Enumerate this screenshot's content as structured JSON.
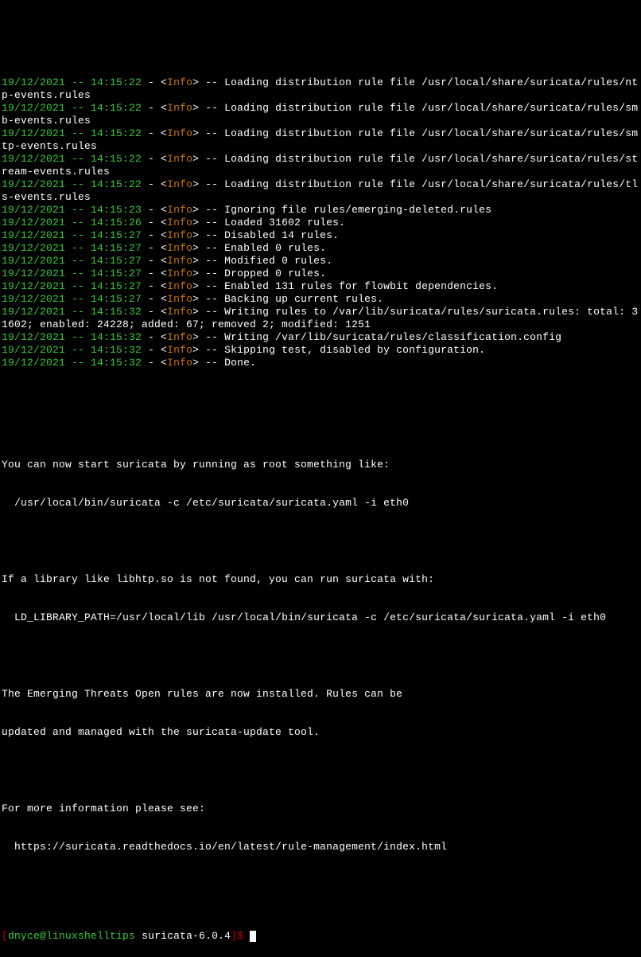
{
  "log": [
    {
      "ts": "19/12/2021 -- 14:15:22",
      "lvl": "Info",
      "msg": "Loading distribution rule file /usr/local/share/suricata/rules/ntp-events.rules"
    },
    {
      "ts": "19/12/2021 -- 14:15:22",
      "lvl": "Info",
      "msg": "Loading distribution rule file /usr/local/share/suricata/rules/smb-events.rules"
    },
    {
      "ts": "19/12/2021 -- 14:15:22",
      "lvl": "Info",
      "msg": "Loading distribution rule file /usr/local/share/suricata/rules/smtp-events.rules"
    },
    {
      "ts": "19/12/2021 -- 14:15:22",
      "lvl": "Info",
      "msg": "Loading distribution rule file /usr/local/share/suricata/rules/stream-events.rules"
    },
    {
      "ts": "19/12/2021 -- 14:15:22",
      "lvl": "Info",
      "msg": "Loading distribution rule file /usr/local/share/suricata/rules/tls-events.rules"
    },
    {
      "ts": "19/12/2021 -- 14:15:23",
      "lvl": "Info",
      "msg": "Ignoring file rules/emerging-deleted.rules"
    },
    {
      "ts": "19/12/2021 -- 14:15:26",
      "lvl": "Info",
      "msg": "Loaded 31602 rules."
    },
    {
      "ts": "19/12/2021 -- 14:15:27",
      "lvl": "Info",
      "msg": "Disabled 14 rules."
    },
    {
      "ts": "19/12/2021 -- 14:15:27",
      "lvl": "Info",
      "msg": "Enabled 0 rules."
    },
    {
      "ts": "19/12/2021 -- 14:15:27",
      "lvl": "Info",
      "msg": "Modified 0 rules."
    },
    {
      "ts": "19/12/2021 -- 14:15:27",
      "lvl": "Info",
      "msg": "Dropped 0 rules."
    },
    {
      "ts": "19/12/2021 -- 14:15:27",
      "lvl": "Info",
      "msg": "Enabled 131 rules for flowbit dependencies."
    },
    {
      "ts": "19/12/2021 -- 14:15:27",
      "lvl": "Info",
      "msg": "Backing up current rules."
    },
    {
      "ts": "19/12/2021 -- 14:15:32",
      "lvl": "Info",
      "msg": "Writing rules to /var/lib/suricata/rules/suricata.rules: total: 31602; enabled: 24228; added: 67; removed 2; modified: 1251"
    },
    {
      "ts": "19/12/2021 -- 14:15:32",
      "lvl": "Info",
      "msg": "Writing /var/lib/suricata/rules/classification.config"
    },
    {
      "ts": "19/12/2021 -- 14:15:32",
      "lvl": "Info",
      "msg": "Skipping test, disabled by configuration."
    },
    {
      "ts": "19/12/2021 -- 14:15:32",
      "lvl": "Info",
      "msg": "Done."
    }
  ],
  "body": {
    "p1l1": "You can now start suricata by running as root something like:",
    "p1l2": "  /usr/local/bin/suricata -c /etc/suricata/suricata.yaml -i eth0",
    "p2l1": "If a library like libhtp.so is not found, you can run suricata with:",
    "p2l2": "  LD_LIBRARY_PATH=/usr/local/lib /usr/local/bin/suricata -c /etc/suricata/suricata.yaml -i eth0",
    "p3l1": "The Emerging Threats Open rules are now installed. Rules can be",
    "p3l2": "updated and managed with the suricata-update tool.",
    "p4l1": "For more information please see:",
    "p4l2": "  https://suricata.readthedocs.io/en/latest/rule-management/index.html"
  },
  "prompt": {
    "lbracket": "[",
    "user": "dnyce",
    "at": "@",
    "host": "linuxshelltips",
    "path": " suricata-6.0.4",
    "rbracket": "]",
    "dollar": "$"
  },
  "glyph": {
    "dash": " - ",
    "lt": "<",
    "gt": ">",
    "dd": " -- "
  }
}
